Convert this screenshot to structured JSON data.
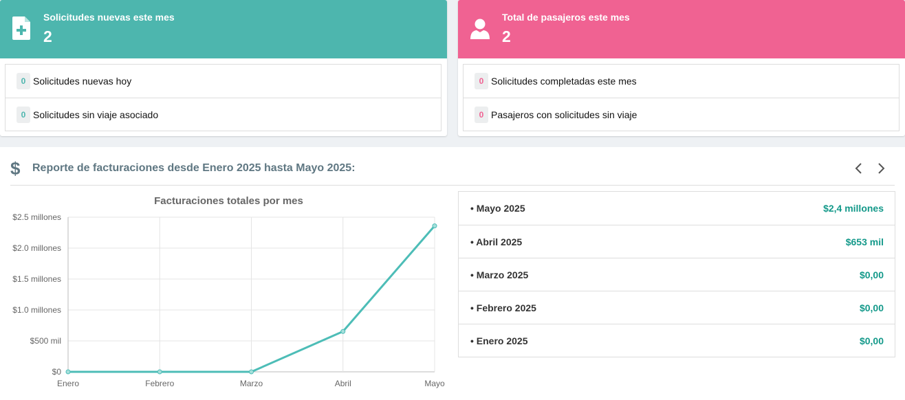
{
  "cards": [
    {
      "title": "Solicitudes nuevas este mes",
      "value": "2",
      "icon": "file-plus-icon",
      "color": "#4db6ae",
      "items": [
        {
          "count": "0",
          "label": "Solicitudes nuevas hoy"
        },
        {
          "count": "0",
          "label": "Solicitudes sin viaje asociado"
        }
      ]
    },
    {
      "title": "Total de pasajeros este mes",
      "value": "2",
      "icon": "user-icon",
      "color": "#f06292",
      "items": [
        {
          "count": "0",
          "label": "Solicitudes completadas este mes"
        },
        {
          "count": "0",
          "label": "Pasajeros con solicitudes sin viaje"
        }
      ]
    }
  ],
  "report": {
    "icon": "dollar-icon",
    "symbol": "$",
    "title": "Reporte de facturaciones desde Enero 2025 hasta Mayo 2025:",
    "prev_icon": "chevron-left-icon",
    "next_icon": "chevron-right-icon",
    "billing": [
      {
        "month": "• Mayo 2025",
        "amount": "$2,4 millones"
      },
      {
        "month": "• Abril 2025",
        "amount": "$653 mil"
      },
      {
        "month": "• Marzo 2025",
        "amount": "$0,00"
      },
      {
        "month": "• Febrero 2025",
        "amount": "$0,00"
      },
      {
        "month": "• Enero 2025",
        "amount": "$0,00"
      }
    ]
  },
  "chart_data": {
    "type": "line",
    "title": "Facturaciones totales por mes",
    "categories": [
      "Enero",
      "Febrero",
      "Marzo",
      "Abril",
      "Mayo"
    ],
    "values": [
      0,
      0,
      0,
      653000,
      2360000
    ],
    "ylim": [
      0,
      2500000
    ],
    "yticks": [
      0,
      500000,
      1000000,
      1500000,
      2000000,
      2500000
    ],
    "ytick_labels": [
      "$0",
      "$500 mil",
      "$1.0 millones",
      "$1.5 millones",
      "$2.0 millones",
      "$2.5 millones"
    ],
    "grid": true,
    "color": "#4dbdb7"
  }
}
